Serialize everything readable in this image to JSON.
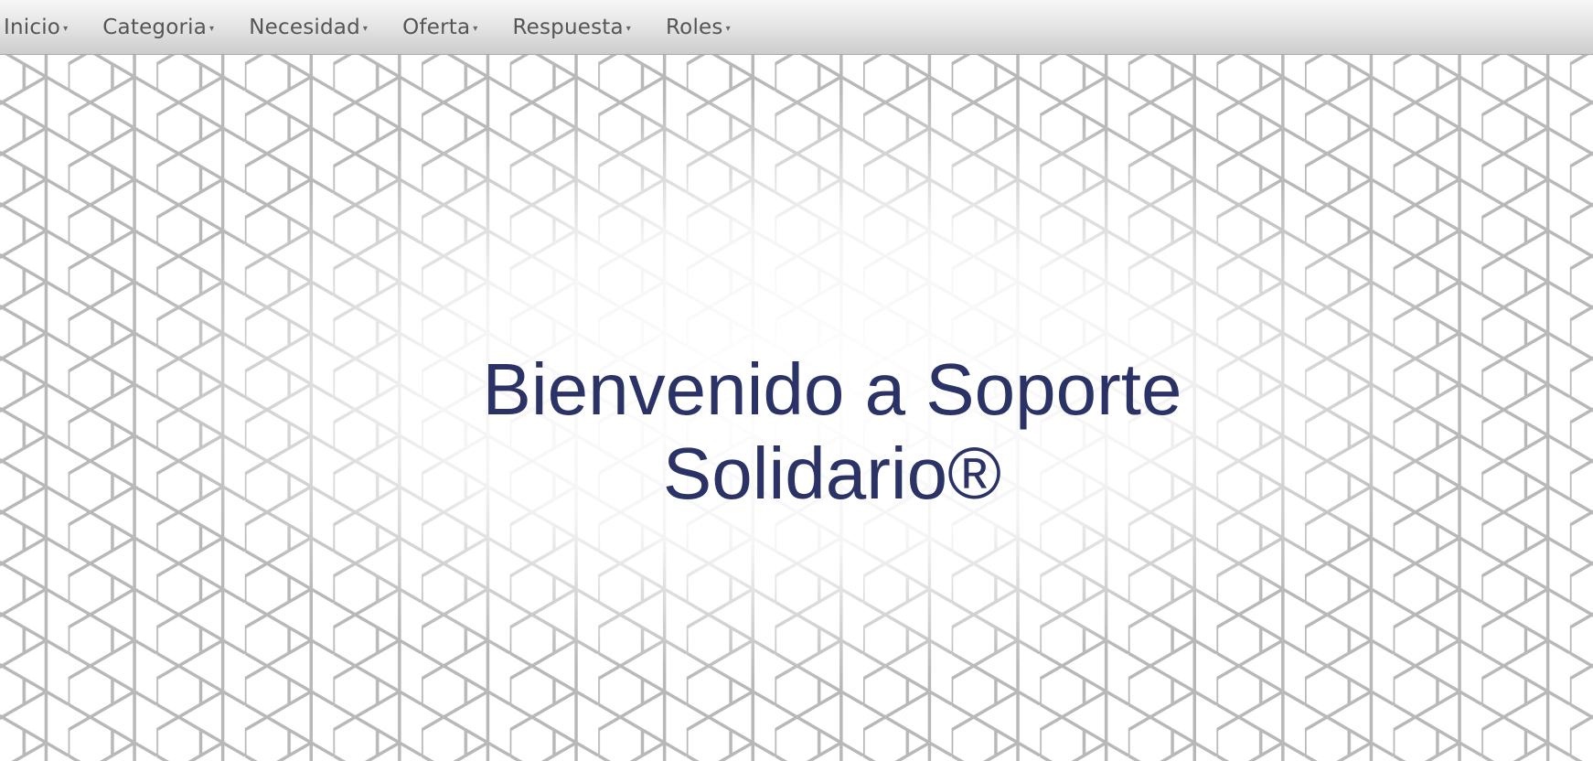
{
  "nav": {
    "items": [
      {
        "label": "Inicio",
        "caret": "▾"
      },
      {
        "label": "Categoria",
        "caret": "▾"
      },
      {
        "label": "Necesidad",
        "caret": "▾"
      },
      {
        "label": "Oferta",
        "caret": "▾"
      },
      {
        "label": "Respuesta",
        "caret": "▾"
      },
      {
        "label": "Roles",
        "caret": "▾"
      }
    ]
  },
  "hero": {
    "title": "Bienvenido a Soporte Solidario®"
  },
  "colors": {
    "title": "#2b3366",
    "nav_text": "#555555",
    "hex_stroke": "#b8b8b8"
  },
  "background": {
    "pattern": "hexagon-grid-icon"
  }
}
